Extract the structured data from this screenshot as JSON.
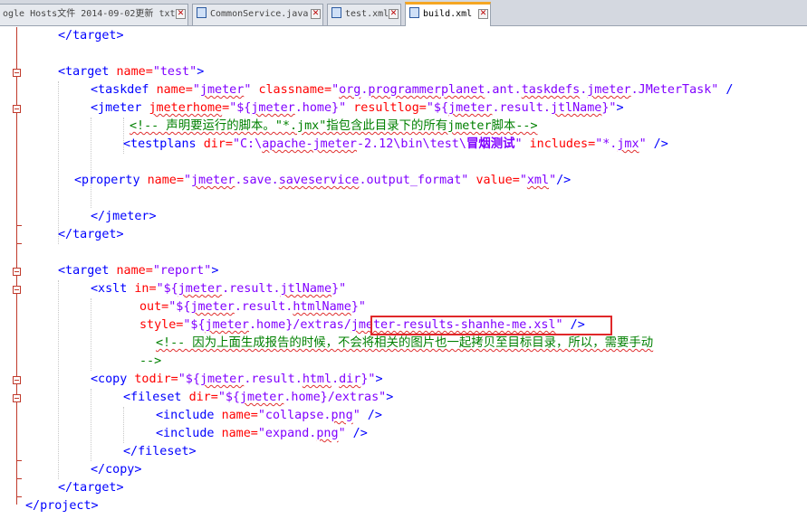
{
  "tabs": [
    {
      "label": "ogle Hosts文件 2014-09-02更新 txt",
      "active": false
    },
    {
      "label": "CommonService.java",
      "active": false
    },
    {
      "label": "test.xml",
      "active": false
    },
    {
      "label": "build.xml",
      "active": true
    }
  ],
  "colors": {
    "tag": "#0000ff",
    "attribute": "#ff0000",
    "value": "#8000ff",
    "comment": "#008000",
    "highlight_box": "#e0282a"
  },
  "code": {
    "l1": "</target>",
    "l3": {
      "tag": "<target",
      "attr": "name=",
      "val": "\"test\"",
      "close": ">"
    },
    "l4": {
      "tag": "<taskdef",
      "a1": "name=",
      "v1a": "\"",
      "v1b": "jmeter",
      "v1c": "\"",
      "a2": "classname=",
      "v2a": "\"",
      "v2b": "org",
      "v2c": ".",
      "v2d": "programmerplanet",
      "v2e": ".ant.",
      "v2f": "taskdefs",
      "v2g": ".",
      "v2h": "jmeter",
      "v2i": ".JMeterTask\"",
      "close": " /"
    },
    "l5": {
      "tag": "<jmeter",
      "a1": "jmeterhome",
      "a1b": "=",
      "v1a": "\"${",
      "v1b": "jmeter",
      "v1c": ".home}\"",
      "a2": "resultlog=",
      "v2a": "\"${",
      "v2b": "jmeter",
      "v2c": ".result.",
      "v2d": "jtlName",
      "v2e": "}\"",
      "close": ">"
    },
    "l6": {
      "text": "<!-- 声明要运行的脚本。\"*.jmx\"指包含此目录下的所有jmeter脚本-->"
    },
    "l7": {
      "tag": "<testplans",
      "a1": "dir=",
      "v1a": "\"C:\\",
      "v1b": "apache-jmeter",
      "v1c": "-2.12\\bin\\test\\",
      "v1d": "冒烟测试",
      "v1e": "\"",
      "a2": "includes=",
      "v2a": "\"*.",
      "v2b": "jmx",
      "v2c": "\"",
      "close": " />"
    },
    "l9": {
      "tag": "<property",
      "a1": "name=",
      "v1a": "\"",
      "v1b": "jmeter",
      "v1c": ".save.",
      "v1d": "saveservice",
      "v1e": ".output_format\"",
      "a2": "value=",
      "v2a": "\"",
      "v2b": "xml",
      "v2c": "\"",
      "close": "/>"
    },
    "l11": "</jmeter>",
    "l12": "</target>",
    "l14": {
      "tag": "<target",
      "attr": "name=",
      "val": "\"report\"",
      "close": ">"
    },
    "l15": {
      "tag": "<xslt",
      "a1": "in=",
      "v1a": "\"${",
      "v1b": "jmeter",
      "v1c": ".result.",
      "v1d": "jtlName",
      "v1e": "}\""
    },
    "l16": {
      "a1": "out=",
      "v1a": "\"${",
      "v1b": "jmeter",
      "v1c": ".result.",
      "v1d": "htmlName",
      "v1e": "}\""
    },
    "l17": {
      "a1": "style=",
      "v1a": "\"${",
      "v1b": "jmeter",
      "v1c": ".home}/extras/",
      "v1d": "jmeter-results-shanhe-me.xsl",
      "v1e": "\"",
      "close": " />"
    },
    "l18": {
      "text": "<!-- 因为上面生成报告的时候，不会将相关的图片也一起拷贝至目标目录，所以，需要手动"
    },
    "l19": {
      "text": "-->"
    },
    "l20": {
      "tag": "<copy",
      "a1": "todir=",
      "v1a": "\"${",
      "v1b": "jmeter",
      "v1c": ".result.",
      "v1d": "html",
      "v1e": ".",
      "v1f": "dir",
      "v1g": "}\"",
      "close": ">"
    },
    "l21": {
      "tag": "<fileset",
      "a1": "dir=",
      "v1a": "\"${",
      "v1b": "jmeter",
      "v1c": ".home}/extras\"",
      "close": ">"
    },
    "l22": {
      "tag": "<include",
      "a1": "name=",
      "v1a": "\"collapse.",
      "v1b": "png",
      "v1c": "\"",
      "close": " />"
    },
    "l23": {
      "tag": "<include",
      "a1": "name=",
      "v1a": "\"expand.",
      "v1b": "png",
      "v1c": "\"",
      "close": " />"
    },
    "l24": "</fileset>",
    "l25": "</copy>",
    "l26": "</target>",
    "l27": "</project>"
  }
}
